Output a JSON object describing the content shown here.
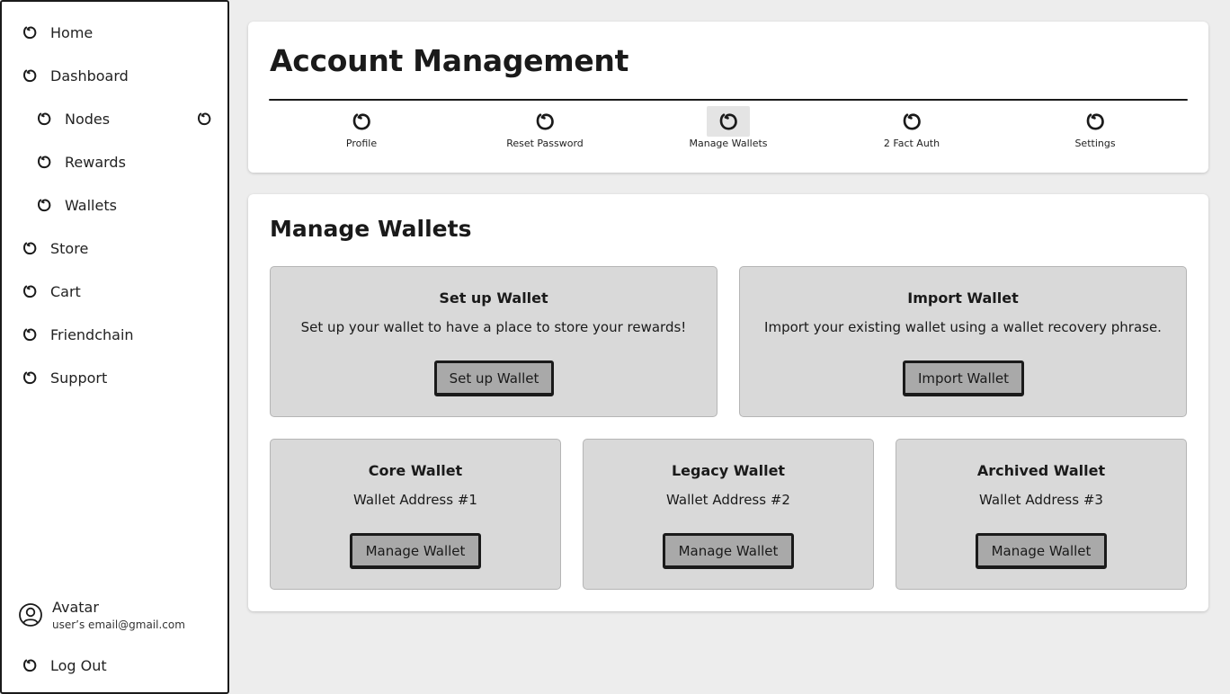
{
  "sidebar": {
    "items": [
      {
        "label": "Home",
        "icon": "circle-scribble-icon"
      },
      {
        "label": "Dashboard",
        "icon": "circle-scribble-icon"
      },
      {
        "label": "Nodes",
        "icon": "circle-scribble-icon"
      },
      {
        "label": "Rewards",
        "icon": "circle-scribble-icon"
      },
      {
        "label": "Wallets",
        "icon": "circle-scribble-icon"
      },
      {
        "label": "Store",
        "icon": "circle-scribble-icon"
      },
      {
        "label": "Cart",
        "icon": "circle-scribble-icon"
      },
      {
        "label": "Friendchain",
        "icon": "circle-scribble-icon"
      },
      {
        "label": "Support",
        "icon": "circle-scribble-icon"
      }
    ],
    "user": {
      "name": "Avatar",
      "email": "user’s email@gmail.com"
    },
    "logout_label": "Log Out"
  },
  "header": {
    "title": "Account Management",
    "tabs": [
      {
        "label": "Profile"
      },
      {
        "label": "Reset Password"
      },
      {
        "label": "Manage Wallets",
        "active": true
      },
      {
        "label": "2 Fact Auth"
      },
      {
        "label": "Settings"
      }
    ]
  },
  "main": {
    "title": "Manage Wallets",
    "actions": [
      {
        "title": "Set up Wallet",
        "description": "Set up your wallet to have a place to store your rewards!",
        "button": "Set up Wallet"
      },
      {
        "title": "Import Wallet",
        "description": "Import your existing wallet using a wallet recovery phrase.",
        "button": "Import Wallet"
      }
    ],
    "wallets": [
      {
        "title": "Core Wallet",
        "address": "Wallet Address #1",
        "button": "Manage Wallet"
      },
      {
        "title": "Legacy Wallet",
        "address": "Wallet Address #2",
        "button": "Manage Wallet"
      },
      {
        "title": "Archived Wallet",
        "address": "Wallet Address #3",
        "button": "Manage Wallet"
      }
    ]
  },
  "colors": {
    "background": "#ededed",
    "card": "#ffffff",
    "box": "#d9d9d9",
    "button": "#a9a9a9",
    "ink": "#1a1a1a"
  }
}
